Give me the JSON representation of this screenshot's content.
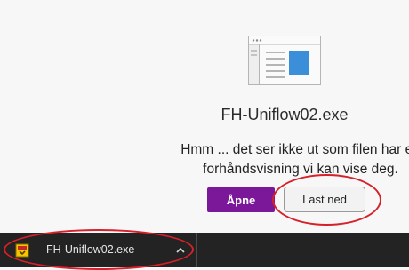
{
  "preview": {
    "file_name": "FH-Uniflow02.exe",
    "message": "Hmm ... det ser ikke ut som filen har en forhåndsvisning vi kan vise deg.",
    "open_label": "Åpne",
    "download_label": "Last ned"
  },
  "download_shelf": {
    "file_name": "FH-Uniflow02.exe"
  },
  "colors": {
    "accent_purple": "#7b189a",
    "highlight_red": "#d6202a",
    "shelf_background": "#232323",
    "panel_background": "#f7f7f7"
  },
  "icons": [
    "file-preview-illustration-icon",
    "exe-file-icon",
    "chevron-up-icon"
  ]
}
